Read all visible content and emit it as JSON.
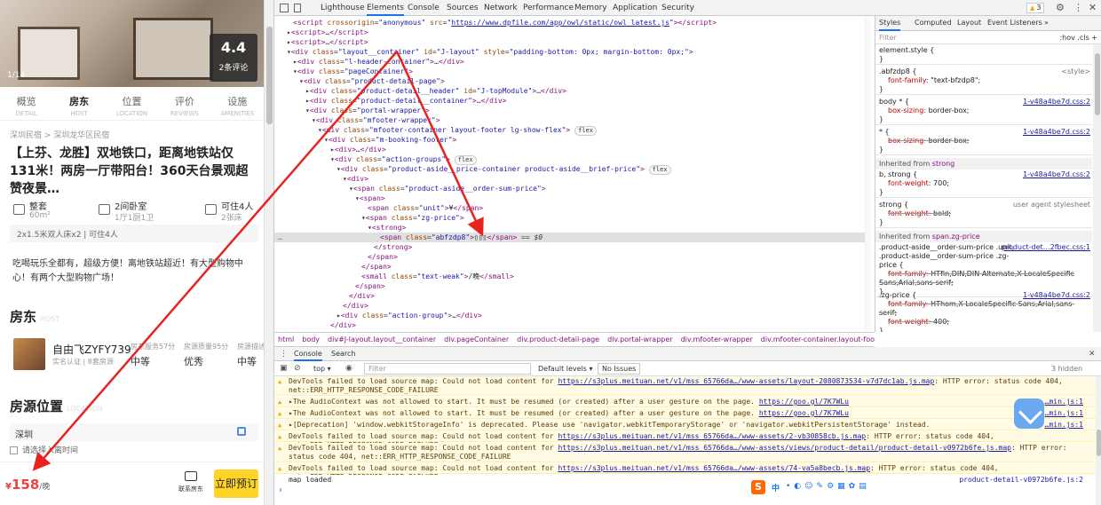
{
  "left_page": {
    "photo_counter": "1/14",
    "rating": {
      "score": "4.4",
      "count": "2条评论"
    },
    "tabs": [
      {
        "label": "概览",
        "sub": "DETAIL"
      },
      {
        "label": "房东",
        "sub": "HOST"
      },
      {
        "label": "位置",
        "sub": "LOCATION"
      },
      {
        "label": "评价",
        "sub": "REVIEWS"
      },
      {
        "label": "设施",
        "sub": "AMENITIES"
      }
    ],
    "breadcrumb": "深圳民宿 > 深圳龙华区民宿",
    "title": "【上芬、龙胜】双地铁口，距离地铁站仅131米！两房一厅带阳台！360天台景观超赞夜景…",
    "features": [
      {
        "line1": "整套",
        "line2": "60m²",
        "icon": "home-icon"
      },
      {
        "line1": "2间卧室",
        "line2": "1厅1厨1卫",
        "icon": "bedroom-icon"
      },
      {
        "line1": "可住4人",
        "line2": "2张床",
        "icon": "bed-icon"
      }
    ],
    "bed_info": "2x1.5米双人床x2 | 可住4人",
    "description": "吃喝玩乐全都有，超级方便！离地铁站超近！有大型购物中心！有两个大型购物广场！",
    "host_heading": "房东",
    "host_heading_sub": "HOST",
    "host": {
      "name": "自由飞ZYFY739",
      "sub": "实名认证 | 8套房源",
      "stats": [
        {
          "label": "房东服务57分",
          "value": "中等"
        },
        {
          "label": "房源质量95分",
          "value": "优秀"
        },
        {
          "label": "房源描述",
          "value": "中等"
        }
      ]
    },
    "location_heading": "房源位置",
    "location_heading_sub": "LOCATION",
    "city": "深圳",
    "date_pick": "请选择入离时间",
    "footer": {
      "currency": "¥",
      "price": "158",
      "unit": "/晚",
      "contact": "联系房东",
      "book": "立即预订"
    }
  },
  "devtools": {
    "tabs": [
      "Lighthouse",
      "Elements",
      "Console",
      "Sources",
      "Network",
      "Performance",
      "Memory",
      "Application",
      "Security"
    ],
    "active_tab": "Elements",
    "warning_count": "3",
    "elements_lines": [
      {
        "html": "<span class='tag'>&lt;script</span> <span class='attr'>crossorigin</span>=<span class='val'>\"anonymous\"</span> <span class='attr'>src</span>=<span class='val'>\"<span class='link'>https://www.dpfile.com/app/owl/static/owl_latest.js</span>\"</span><span class='tag'>&gt;&lt;/script&gt;</span>",
        "indent": 3
      },
      {
        "html": "▸<span class='tag'>&lt;script&gt;</span>…<span class='tag'>&lt;/script&gt;</span>",
        "indent": 2
      },
      {
        "html": "▸<span class='tag'>&lt;script&gt;</span>…<span class='tag'>&lt;/script&gt;</span>",
        "indent": 2
      },
      {
        "html": "▾<span class='tag'>&lt;div</span> <span class='attr'>class</span>=<span class='val'>\"layout__container\"</span> <span class='attr'>id</span>=<span class='val'>\"J-layout\"</span> <span class='attr'>style</span>=<span class='val'>\"padding-bottom: 0px; margin-bottom: 0px;\"</span><span class='tag'>&gt;</span>",
        "indent": 2
      },
      {
        "html": "▸<span class='tag'>&lt;div</span> <span class='attr'>class</span>=<span class='val'>\"l-header-container\"</span><span class='tag'>&gt;</span>…<span class='tag'>&lt;/div&gt;</span>",
        "indent": 3
      },
      {
        "html": "▾<span class='tag'>&lt;div</span> <span class='attr'>class</span>=<span class='val'>\"pageContainer\"</span><span class='tag'>&gt;</span>",
        "indent": 3
      },
      {
        "html": "▾<span class='tag'>&lt;div</span> <span class='attr'>class</span>=<span class='val'>\"product-detail-page\"</span><span class='tag'>&gt;</span>",
        "indent": 4
      },
      {
        "html": "▸<span class='tag'>&lt;div</span> <span class='attr'>class</span>=<span class='val'>\"product-detail__header\"</span> <span class='attr'>id</span>=<span class='val'>\"J-topModule\"</span><span class='tag'>&gt;</span>…<span class='tag'>&lt;/div&gt;</span>",
        "indent": 5
      },
      {
        "html": "▸<span class='tag'>&lt;div</span> <span class='attr'>class</span>=<span class='val'>\"product-detail__container\"</span><span class='tag'>&gt;</span>…<span class='tag'>&lt;/div&gt;</span>",
        "indent": 5
      },
      {
        "html": "▾<span class='tag'>&lt;div</span> <span class='attr'>class</span>=<span class='val'>\"portal-wrapper\"</span><span class='tag'>&gt;</span>",
        "indent": 5
      },
      {
        "html": "▾<span class='tag'>&lt;div</span> <span class='attr'>class</span>=<span class='val'>\"mfooter-wrapper\"</span><span class='tag'>&gt;</span>",
        "indent": 6
      },
      {
        "html": "▾<span class='tag'>&lt;div</span> <span class='attr'>class</span>=<span class='val'>\"mfooter-container layout-footer lg-show-flex\"</span><span class='tag'>&gt;</span> <span class='flex'>flex</span>",
        "indent": 7
      },
      {
        "html": "▾<span class='tag'>&lt;div</span> <span class='attr'>class</span>=<span class='val'>\"m-booking-footer\"</span><span class='tag'>&gt;</span>",
        "indent": 8
      },
      {
        "html": "▸<span class='tag'>&lt;div&gt;</span>…<span class='tag'>&lt;/div&gt;</span>",
        "indent": 9
      },
      {
        "html": "▾<span class='tag'>&lt;div</span> <span class='attr'>class</span>=<span class='val'>\"action-groups\"</span><span class='tag'>&gt;</span> <span class='flex'>flex</span>",
        "indent": 9
      },
      {
        "html": "▾<span class='tag'>&lt;div</span> <span class='attr'>class</span>=<span class='val'>\"product-aside__price-container product-aside__brief-price\"</span><span class='tag'>&gt;</span> <span class='flex'>flex</span>",
        "indent": 10
      },
      {
        "html": "▾<span class='tag'>&lt;div&gt;</span>",
        "indent": 11
      },
      {
        "html": "▾<span class='tag'>&lt;span</span> <span class='attr'>class</span>=<span class='val'>\"product-aside__order-sum-price\"</span><span class='tag'>&gt;</span>",
        "indent": 12
      },
      {
        "html": "▾<span class='tag'>&lt;span&gt;</span>",
        "indent": 13
      },
      {
        "html": "<span class='tag'>&lt;span</span> <span class='attr'>class</span>=<span class='val'>\"unit\"</span><span class='tag'>&gt;</span><span class='txt'>¥</span><span class='tag'>&lt;/span&gt;</span>",
        "indent": 15
      },
      {
        "html": "▾<span class='tag'>&lt;span</span> <span class='attr'>class</span>=<span class='val'>\"zg-price\"</span><span class='tag'>&gt;</span>",
        "indent": 14
      },
      {
        "html": "▾<span class='tag'>&lt;strong&gt;</span>",
        "indent": 15
      },
      {
        "html": "<span class='tag'>&lt;span</span> <span class='attr'>class</span>=<span class='val'>\"abfzdp8\"</span><span class='tag'>&gt;</span><span class='txt'>▯▯▯</span><span class='tag'>&lt;/span&gt;</span> == <i>$0</i>",
        "indent": 17,
        "selected": true
      },
      {
        "html": "<span class='tag'>&lt;/strong&gt;</span>",
        "indent": 16
      },
      {
        "html": "<span class='tag'>&lt;/span&gt;</span>",
        "indent": 15
      },
      {
        "html": "<span class='tag'>&lt;/span&gt;</span>",
        "indent": 14
      },
      {
        "html": "<span class='tag'>&lt;small</span> <span class='attr'>class</span>=<span class='val'>\"text-weak\"</span><span class='tag'>&gt;</span><span class='txt'>/晚</span><span class='tag'>&lt;/small&gt;</span>",
        "indent": 14
      },
      {
        "html": "<span class='tag'>&lt;/span&gt;</span>",
        "indent": 13
      },
      {
        "html": "<span class='tag'>&lt;/div&gt;</span>",
        "indent": 12
      },
      {
        "html": "<span class='tag'>&lt;/div&gt;</span>",
        "indent": 11
      },
      {
        "html": "▸<span class='tag'>&lt;div</span> <span class='attr'>class</span>=<span class='val'>\"action-group\"</span><span class='tag'>&gt;</span>…<span class='tag'>&lt;/div&gt;</span>",
        "indent": 10
      },
      {
        "html": "<span class='tag'>&lt;/div&gt;</span>",
        "indent": 9
      }
    ],
    "styles_tabs": [
      "Styles",
      "Computed",
      "Layout",
      "Event Listeners",
      "»"
    ],
    "styles_filter": "Filter",
    "styles_filter_right": ":hov  .cls  +",
    "rules": [
      {
        "selector": "element.style {",
        "src": "",
        "props": [],
        "strike": false
      },
      {
        "selector": ".abfzdp8 {",
        "src": "<style>",
        "plain": true,
        "props": [
          [
            "font-family",
            "\"text-bfzdp8\";"
          ]
        ]
      },
      {
        "selector": "body * {",
        "src": "1-v48a4be7d.css:2",
        "props": [
          [
            "box-sizing",
            "border-box;"
          ]
        ]
      },
      {
        "selector": "* {",
        "src": "1-v48a4be7d.css:2",
        "props": [
          [
            "box-sizing",
            "border-box;"
          ]
        ],
        "strike": true
      },
      {
        "inherited": "Inherited from",
        "tag": "strong"
      },
      {
        "selector": "b, strong {",
        "src": "1-v48a4be7d.css:2",
        "props": [
          [
            "font-weight",
            "700;"
          ]
        ]
      },
      {
        "selector": "strong {",
        "src": "user agent stylesheet",
        "plain": true,
        "props": [
          [
            "font-weight",
            "bold;"
          ]
        ],
        "strike": true
      },
      {
        "inherited": "Inherited from",
        "tag": "span.zg-price"
      },
      {
        "selector": ".product-aside__order-sum-price .unit, .product-aside__order-sum-price .zg-price {",
        "src": "product-det…2fbec.css:1",
        "props": [
          [
            "font-family",
            "HTfin,DIN,DIN Alternate,X-LocaleSpecific Sans,Arial,sans-serif;"
          ]
        ],
        "strike": true
      },
      {
        "selector": ".zg-price {",
        "src": "1-v48a4be7d.css:2",
        "props": [
          [
            "font-family",
            "HThom,X-LocaleSpecific Sans,Arial,sans-serif;"
          ],
          [
            "font-weight",
            "400;"
          ]
        ],
        "strike": true
      },
      {
        "inherited": "Inherited from",
        "tag": "span.product-aside__order-…"
      }
    ],
    "breadcrumbs": [
      "html",
      "body",
      "div#J-layout.layout__container",
      "div.pageContainer",
      "div.product-detail-page",
      "div.portal-wrapper",
      "div.mfooter-wrapper",
      "div.mfooter-container.layout-footer.lg-show-fle"
    ],
    "drawer_tabs": [
      "Console",
      "Search"
    ],
    "console_bar": {
      "context": "top",
      "filter": "Filter",
      "levels": "Default levels ▾",
      "issues": "No Issues",
      "hidden": "3 hidden"
    },
    "console_messages": [
      {
        "type": "warn",
        "text": "DevTools failed to load source map: Could not load content for ",
        "url": "https://s3plus.meituan.net/v1/mss_65766da…/www-assets/layout-2080873534-v7d7dc1ab.js.map",
        "rest": ": HTTP error: status code 404, net::ERR_HTTP_RESPONSE_CODE_FAILURE",
        "lines": 2
      },
      {
        "type": "warn",
        "text": "▸The AudioContext was not allowed to start. It must be resumed (or created) after a user gesture on the page. ",
        "url": "https://goo.gl/7K7WLu",
        "rest": "",
        "src": "…min.js:1",
        "lines": 1
      },
      {
        "type": "warn",
        "text": "▸The AudioContext was not allowed to start. It must be resumed (or created) after a user gesture on the page. ",
        "url": "https://goo.gl/7K7WLu",
        "rest": "",
        "src": "…min.js:1",
        "lines": 1
      },
      {
        "type": "warn",
        "text": "▸[Deprecation] 'window.webkitStorageInfo' is deprecated. Please use 'navigator.webkitTemporaryStorage' or 'navigator.webkitPersistentStorage' instead.",
        "url": "",
        "rest": "",
        "src": "…min.js:1",
        "lines": 1
      },
      {
        "type": "warn",
        "text": "DevTools failed to load source map: Could not load content for ",
        "url": "https://s3plus.meituan.net/v1/mss_65766da…/www-assets/2-vb30858cb.js.map",
        "rest": ": HTTP error: status code 404, net::ERR_HTTP_RESPONSE_CODE_FAILURE",
        "lines": 1
      },
      {
        "type": "warn",
        "text": "DevTools failed to load source map: Could not load content for ",
        "url": "https://s3plus.meituan.net/v1/mss_65766da…/www-assets/views/product-detail/product-detail-v0972b6fe.js.map",
        "rest": ": HTTP error: status code 404, net::ERR_HTTP_RESPONSE_CODE_FAILURE",
        "lines": 2
      },
      {
        "type": "warn",
        "text": "DevTools failed to load source map: Could not load content for ",
        "url": "https://s3plus.meituan.net/v1/mss_65766da…/www-assets/74-va5a8becb.js.map",
        "rest": ": HTTP error: status code 404, net::ERR_HTTP_RESPONSE_CODE_FAILURE",
        "lines": 1
      },
      {
        "type": "log",
        "text": "map loaded",
        "url": "",
        "rest": "",
        "src": "product-detail-v0972b6fe.js:2",
        "lines": 1
      }
    ],
    "prompt": "›",
    "ime_label": "中",
    "colors": {
      "accent": "#1a73e8",
      "warning_bg": "#fffbe5",
      "arrow": "#e8231f"
    }
  }
}
